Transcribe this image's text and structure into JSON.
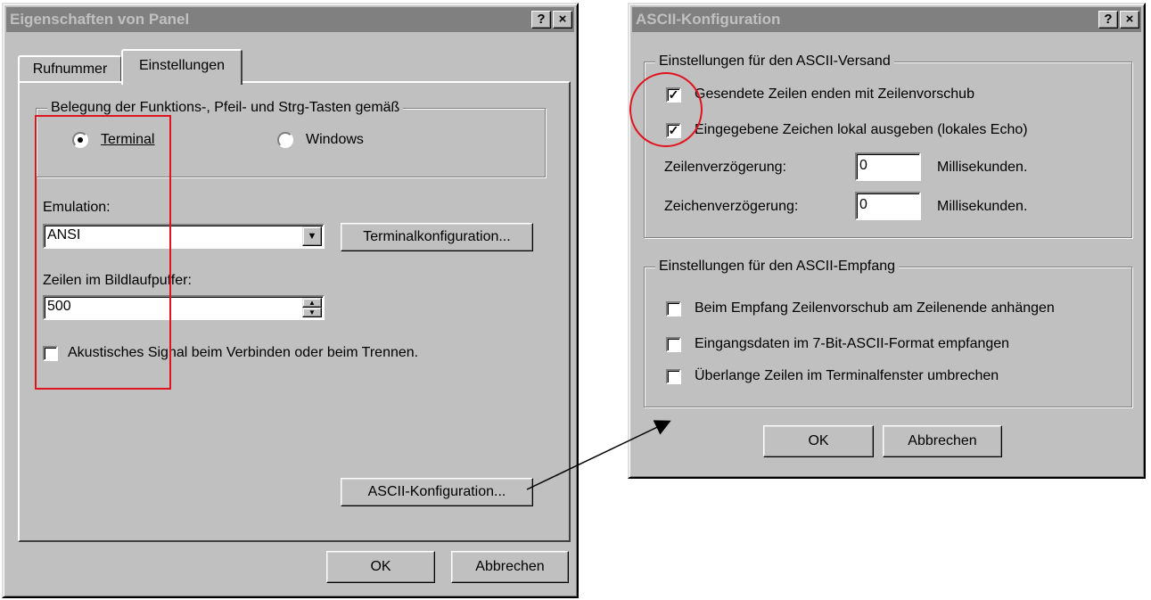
{
  "left_dialog": {
    "title": "Eigenschaften von Panel",
    "help_btn": "?",
    "close_btn": "×",
    "tabs": [
      "Rufnummer",
      "Einstellungen"
    ],
    "group_title": "Belegung der Funktions-, Pfeil- und Strg-Tasten gemäß",
    "radio_terminal": "Terminal",
    "radio_windows": "Windows",
    "emulation_label": "Emulation:",
    "emulation_value": "ANSI",
    "terminal_config_btn": "Terminalkonfiguration...",
    "buffer_label": "Zeilen im Bildlaufpuffer:",
    "buffer_value": "500",
    "acoustic_label": "Akustisches Signal beim Verbinden oder beim Trennen.",
    "ascii_btn": "ASCII-Konfiguration...",
    "ok": "OK",
    "cancel": "Abbrechen"
  },
  "right_dialog": {
    "title": "ASCII-Konfiguration",
    "help_btn": "?",
    "close_btn": "×",
    "send_group": "Einstellungen für den ASCII-Versand",
    "send_cb1": "Gesendete Zeilen enden mit Zeilenvorschub",
    "send_cb2": "Eingegebene Zeichen lokal ausgeben (lokales Echo)",
    "line_delay_label": "Zeilenverzögerung:",
    "line_delay_value": "0",
    "char_delay_label": "Zeichenverzögerung:",
    "char_delay_value": "0",
    "ms_unit": "Millisekunden.",
    "recv_group": "Einstellungen für den ASCII-Empfang",
    "recv_cb1": "Beim Empfang Zeilenvorschub am Zeilenende anhängen",
    "recv_cb2": "Eingangsdaten im 7-Bit-ASCII-Format empfangen",
    "recv_cb3": "Überlange Zeilen im Terminalfenster umbrechen",
    "ok": "OK",
    "cancel": "Abbrechen"
  },
  "colors": {
    "annotation_red": "#e0141e",
    "dialog_gray": "#c0c0c0",
    "inactive_title": "#808080"
  }
}
